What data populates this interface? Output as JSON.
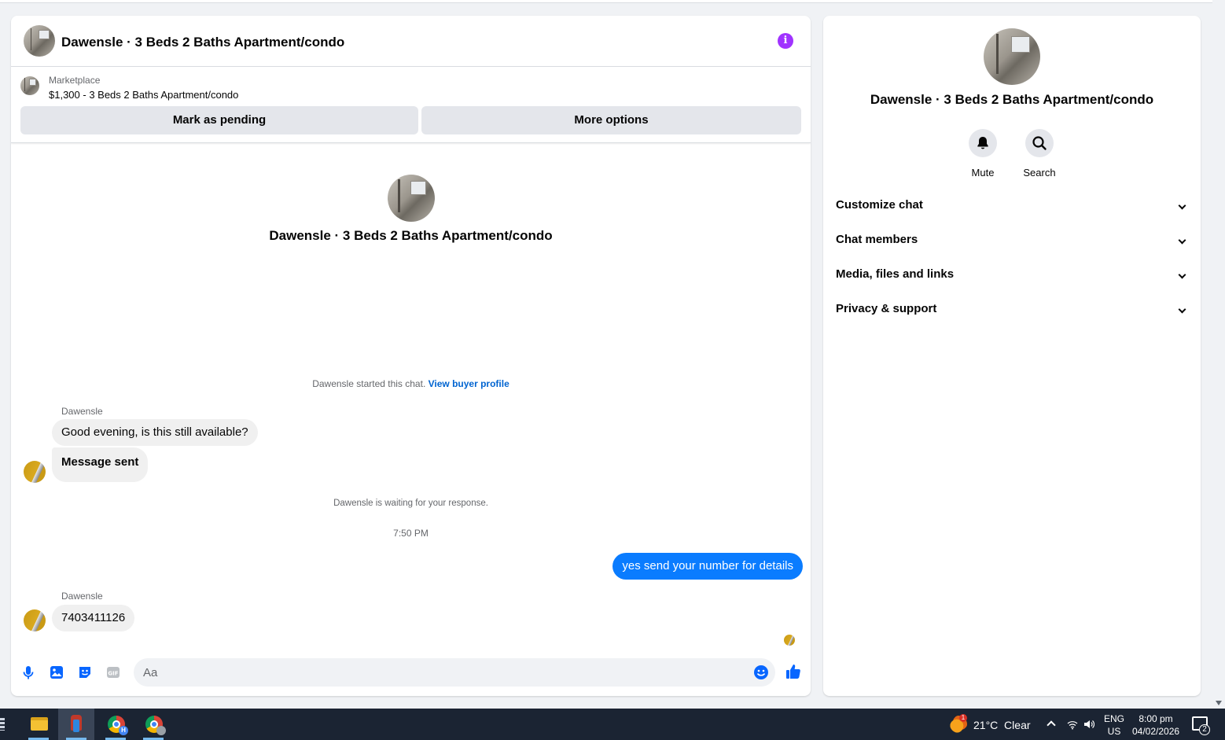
{
  "chat": {
    "header_title": "Dawensle · 3 Beds 2 Baths Apartment/condo",
    "listing": {
      "category": "Marketplace",
      "name": "$1,300 - 3 Beds 2 Baths Apartment/condo"
    },
    "buttons": {
      "pending": "Mark as pending",
      "more": "More options"
    },
    "intro_title": "Dawensle · 3 Beds 2 Baths Apartment/condo",
    "started_text": "Dawensle started this chat.",
    "buyer_profile_link": "View buyer profile",
    "messages": [
      {
        "sender": "Dawensle",
        "text": "Good evening, is this still available?"
      },
      {
        "text": "Message sent"
      },
      {
        "system": "Dawensle is waiting for your response."
      },
      {
        "timestamp": "7:50 PM"
      },
      {
        "outgoing": "yes send your number for details"
      },
      {
        "sender": "Dawensle",
        "text": "7403411126"
      }
    ],
    "composer_placeholder": "Aa"
  },
  "side": {
    "title": "Dawensle · 3 Beds 2 Baths Apartment/condo",
    "actions": {
      "mute": "Mute",
      "search": "Search"
    },
    "sections": [
      "Customize chat",
      "Chat members",
      "Media, files and links",
      "Privacy & support"
    ]
  },
  "taskbar": {
    "weather_badge": "1",
    "weather": "21°C  Clear",
    "lang_1": "ENG",
    "lang_2": "US",
    "time": "8:00 pm",
    "date": "04/02/2026",
    "notification_count": "2",
    "chrome_profile": "H"
  },
  "colors": {
    "accent": "#0a7cff",
    "info": "#a033ff",
    "link": "#0064d1"
  }
}
